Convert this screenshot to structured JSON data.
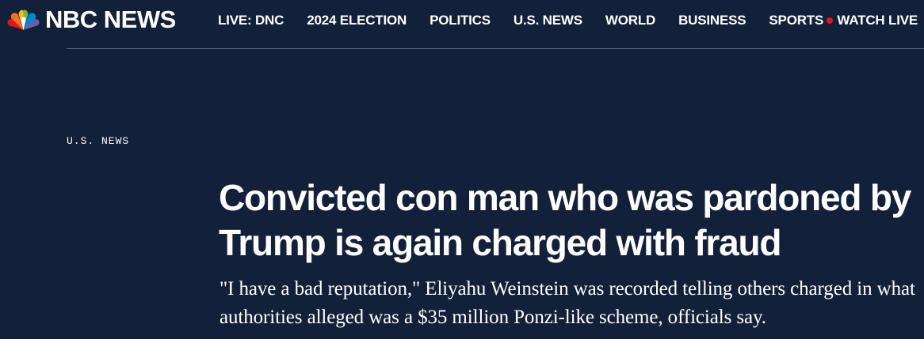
{
  "header": {
    "logo_text": "NBC NEWS",
    "nav": [
      {
        "label": "LIVE: DNC"
      },
      {
        "label": "2024 ELECTION"
      },
      {
        "label": "POLITICS"
      },
      {
        "label": "U.S. NEWS"
      },
      {
        "label": "WORLD"
      },
      {
        "label": "BUSINESS"
      },
      {
        "label": "SPORTS"
      }
    ],
    "watch_live": "WATCH LIVE"
  },
  "article": {
    "section": "U.S. NEWS",
    "headline": "Convicted con man who was pardoned by Trump is again charged with fraud",
    "dek": "\"I have a bad reputation,\" Eliyahu Weinstein was recorded telling others charged in what authorities alleged was a $35 million Ponzi-like scheme, officials say."
  },
  "colors": {
    "background": "#132039",
    "text": "#ffffff",
    "live_dot": "#e1151b",
    "divider": "#5a6478"
  },
  "icons": {
    "logo": "nbc-peacock-icon",
    "live": "live-dot-icon"
  }
}
